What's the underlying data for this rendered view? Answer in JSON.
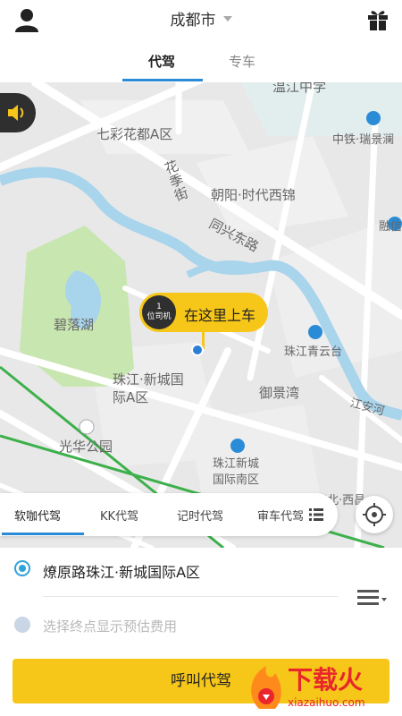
{
  "header": {
    "city": "成都市"
  },
  "tabs": [
    {
      "label": "代驾",
      "active": true
    },
    {
      "label": "专车",
      "active": false
    }
  ],
  "map": {
    "labels": {
      "school": "温江中学",
      "community1": "七彩花都A区",
      "station": "中铁·瑞景澜",
      "street1": "花季街",
      "building1": "朝阳·时代西锦",
      "road1": "同兴东路",
      "building2": "融信",
      "lake": "碧落湖",
      "pavilion": "珠江青云台",
      "community2": "珠江·新城国际A区",
      "community3": "御景湾",
      "river": "江安河",
      "park": "光华公园",
      "community4": "珠江新城国际南区",
      "community5": "光华北·西昌"
    },
    "pin": {
      "badge_line1": "1",
      "badge_line2": "位司机",
      "text": "在这里上车"
    }
  },
  "services": [
    {
      "label": "软咖代驾",
      "active": true
    },
    {
      "label": "KK代驾",
      "active": false
    },
    {
      "label": "记时代驾",
      "active": false
    },
    {
      "label": "审车代驾",
      "active": false
    }
  ],
  "trip": {
    "start": "燎原路珠江·新城国际A区",
    "destination_placeholder": "选择终点显示预估费用",
    "call_button": "呼叫代驾"
  },
  "watermark": {
    "text": "下载火",
    "sub": "xiazaihuo.com"
  },
  "colors": {
    "accent_yellow": "#F6C619",
    "accent_blue": "#2A8BD6",
    "river": "#A8D4EC",
    "park": "#C8E6B0"
  }
}
